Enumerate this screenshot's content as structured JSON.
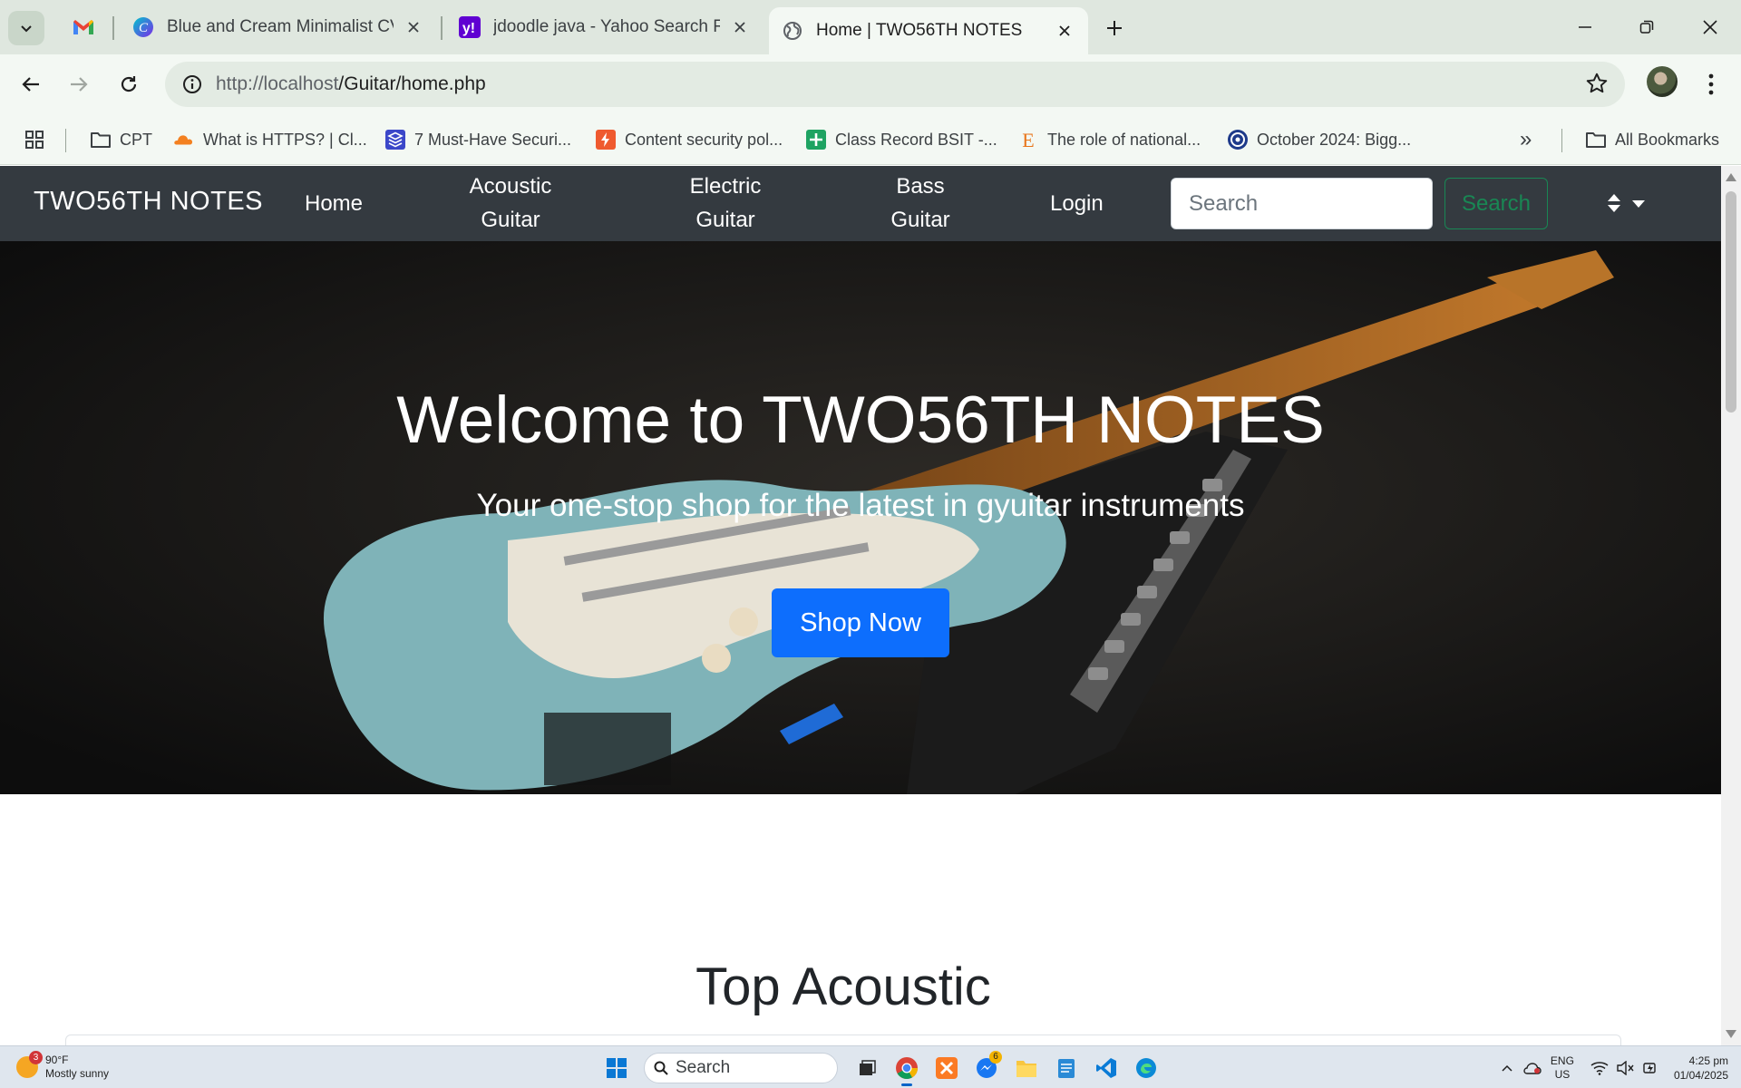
{
  "browser": {
    "tabs": [
      {
        "title": "Blue and Cream Minimalist CV Resume"
      },
      {
        "title": "jdoodle java - Yahoo Search Results"
      },
      {
        "title": "Home | TWO56TH NOTES"
      }
    ],
    "url_host": "http://localhost",
    "url_path": "/Guitar/home.php",
    "bookmarks": [
      {
        "label": "CPT"
      },
      {
        "label": "What is HTTPS? | Cl..."
      },
      {
        "label": "7 Must-Have Securi..."
      },
      {
        "label": "Content security pol..."
      },
      {
        "label": "Class Record BSIT -..."
      },
      {
        "label": "The role of national..."
      },
      {
        "label": "October 2024: Bigg..."
      }
    ],
    "more_bookmarks": "»",
    "all_bookmarks": "All Bookmarks"
  },
  "site": {
    "brand": "TWO56TH NOTES",
    "nav": {
      "home": "Home",
      "acoustic_1": "Acoustic",
      "acoustic_2": "Guitar",
      "electric_1": "Electric",
      "electric_2": "Guitar",
      "bass_1": "Bass",
      "bass_2": "Guitar",
      "login": "Login"
    },
    "search_placeholder": "Search",
    "search_button": "Search",
    "hero": {
      "title": "Welcome to TWO56TH NOTES",
      "subtitle": "Your one-stop shop for the latest in gyuitar instruments",
      "cta": "Shop Now"
    },
    "section_title": "Top Acoustic"
  },
  "taskbar": {
    "weather_temp": "90°F",
    "weather_desc": "Mostly sunny",
    "weather_badge": "3",
    "search": "Search",
    "messenger_badge": "6",
    "lang_1": "ENG",
    "lang_2": "US",
    "time": "4:25 pm",
    "date": "01/04/2025"
  },
  "colors": {
    "tabstrip": "#dfe7df",
    "toolbar": "#f3f8f3",
    "site_navbar": "#343a40",
    "primary_button": "#0d6efd",
    "success_outline": "#198754"
  },
  "icons": [
    "tab-search-icon",
    "gmail-icon",
    "canva-icon",
    "yahoo-icon",
    "globe-icon",
    "close-icon",
    "plus-icon",
    "minimize-icon",
    "restore-icon",
    "window-close-icon",
    "back-icon",
    "forward-icon",
    "reload-icon",
    "site-info-icon",
    "star-icon",
    "apps-icon",
    "folder-icon",
    "cloudflare-icon",
    "stack-icon",
    "bolt-icon",
    "sheets-icon",
    "e-icon",
    "target-icon",
    "theme-toggle-icon",
    "windows-start-icon",
    "search-icon",
    "chrome-icon",
    "messenger-icon",
    "file-explorer-icon",
    "notepad-icon",
    "vscode-icon",
    "edge-icon",
    "wifi-icon",
    "volume-icon"
  ]
}
